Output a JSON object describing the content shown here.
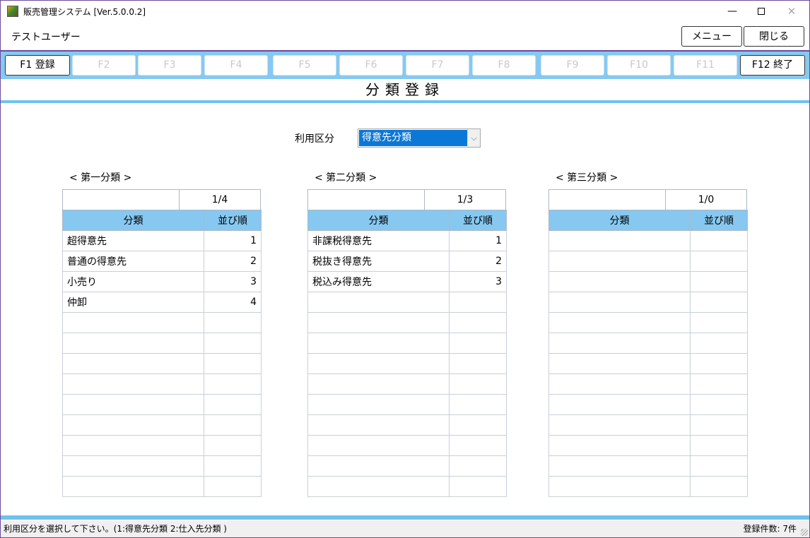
{
  "window": {
    "title": "販売管理システム [Ver.5.0.0.2]",
    "min_glyph": "—",
    "close_glyph": "✕"
  },
  "header": {
    "user_name": "テストユーザー",
    "menu_label": "メニュー",
    "close_label": "閉じる"
  },
  "fkeys": [
    {
      "label": "F1 登録",
      "enabled": true
    },
    {
      "label": "F2",
      "enabled": false
    },
    {
      "label": "F3",
      "enabled": false
    },
    {
      "label": "F4",
      "enabled": false
    },
    {
      "label": "F5",
      "enabled": false
    },
    {
      "label": "F6",
      "enabled": false
    },
    {
      "label": "F7",
      "enabled": false
    },
    {
      "label": "F8",
      "enabled": false
    },
    {
      "label": "F9",
      "enabled": false
    },
    {
      "label": "F10",
      "enabled": false
    },
    {
      "label": "F11",
      "enabled": false
    },
    {
      "label": "F12 終了",
      "enabled": true
    }
  ],
  "page_title": "分類登録",
  "usage": {
    "label": "利用区分",
    "selected": "得意先分類",
    "arrow_glyph": "⌵"
  },
  "panels": [
    {
      "title": "< 第一分類 >",
      "count": "1/4",
      "col_name": "分類",
      "col_order": "並び順",
      "rows": [
        {
          "name": "超得意先",
          "order": "1"
        },
        {
          "name": "普通の得意先",
          "order": "2"
        },
        {
          "name": "小売り",
          "order": "3"
        },
        {
          "name": "仲卸",
          "order": "4"
        }
      ]
    },
    {
      "title": "< 第二分類 >",
      "count": "1/3",
      "col_name": "分類",
      "col_order": "並び順",
      "rows": [
        {
          "name": "非課税得意先",
          "order": "1"
        },
        {
          "name": "税抜き得意先",
          "order": "2"
        },
        {
          "name": "税込み得意先",
          "order": "3"
        }
      ]
    },
    {
      "title": "< 第三分類 >",
      "count": "1/0",
      "col_name": "分類",
      "col_order": "並び順",
      "rows": []
    }
  ],
  "status": {
    "message": "利用区分を選択して下さい。(1:得意先分類 2:仕入先分類 )",
    "count": "登録件数: 7件"
  },
  "colors": {
    "accent": "#87c8f0",
    "rule": "#6ec2f0",
    "selection": "#0a78d7",
    "frame": "#6a4c9c"
  }
}
